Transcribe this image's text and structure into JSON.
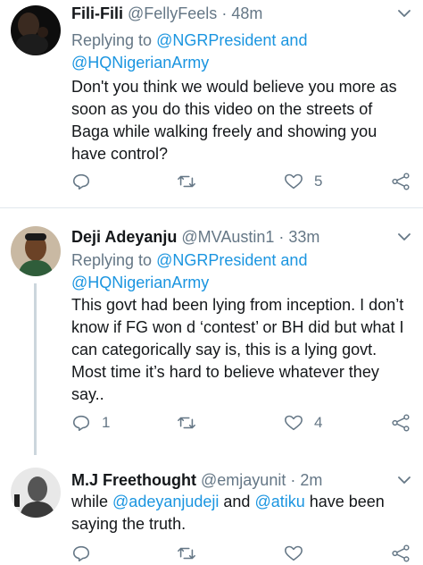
{
  "tweets": [
    {
      "name": "Fili-Fili",
      "handle": "@FellyFeels",
      "separator": "·",
      "time": "48m",
      "replying_prefix": "Replying to",
      "mention1": "@NGRPresident",
      "and_word": "and",
      "mention2": "@HQNigerianArmy",
      "body": "Don't you think we would believe you more as soon as you do this video on the streets of Baga while walking freely and showing you have control?",
      "reply_count": "",
      "retweet_count": "",
      "like_count": "5"
    },
    {
      "name": "Deji Adeyanju",
      "handle": "@MVAustin1",
      "separator": "·",
      "time": "33m",
      "replying_prefix": "Replying to",
      "mention1": "@NGRPresident",
      "and_word": "and",
      "mention2": "@HQNigerianArmy",
      "body": "This govt had been lying from inception. I don’t know if FG won d ‘contest’ or BH did but what I can categorically say is, this is a lying govt. Most time it’s hard to believe whatever they say..",
      "reply_count": "1",
      "retweet_count": "",
      "like_count": "4"
    },
    {
      "name": "M.J Freethought",
      "handle": "@emjayunit",
      "separator": "·",
      "time": "2m",
      "body_pre": "while ",
      "mention1": "@adeyanjudeji",
      "body_mid": " and ",
      "mention2": "@atiku",
      "body_post": " have been saying the truth.",
      "reply_count": "",
      "retweet_count": "",
      "like_count": ""
    }
  ],
  "icons": {
    "reply": "reply-icon",
    "retweet": "retweet-icon",
    "like": "heart-icon",
    "share": "share-icon",
    "menu": "chevron-down-icon"
  },
  "colors": {
    "link": "#1b95e0",
    "secondary_text": "#657786",
    "icon": "#657786",
    "divider": "#e1e8ed",
    "thread_line": "#ccd6dd"
  }
}
